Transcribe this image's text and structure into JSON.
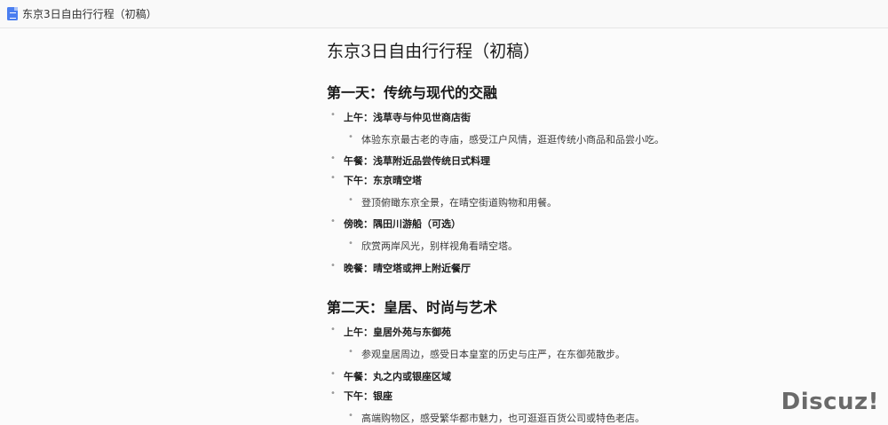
{
  "tab": {
    "title": "东京3日自由行行程（初稿）",
    "icon": "google-docs-icon"
  },
  "document": {
    "title": "东京3日自由行行程（初稿）",
    "sections": [
      {
        "heading": "第一天：传统与现代的交融",
        "items": [
          {
            "label": "上午：浅草寺与仲见世商店街",
            "sub": "体验东京最古老的寺庙，感受江户风情，逛逛传统小商品和品尝小吃。"
          },
          {
            "label": "午餐：浅草附近品尝传统日式料理"
          },
          {
            "label": "下午：东京晴空塔",
            "sub": "登顶俯瞰东京全景，在晴空街道购物和用餐。"
          },
          {
            "label": "傍晚：隅田川游船（可选）",
            "sub": "欣赏两岸风光，别样视角看晴空塔。"
          },
          {
            "label": "晚餐：晴空塔或押上附近餐厅"
          }
        ]
      },
      {
        "heading": "第二天：皇居、时尚与艺术",
        "items": [
          {
            "label": "上午：皇居外苑与东御苑",
            "sub": "参观皇居周边，感受日本皇室的历史与庄严，在东御苑散步。"
          },
          {
            "label": "午餐：丸之内或银座区域"
          },
          {
            "label": "下午：银座",
            "sub": "高端购物区，感受繁华都市魅力，也可逛逛百货公司或特色老店。"
          }
        ]
      }
    ]
  },
  "bullet_glyph": "•",
  "watermark": "Discuz!"
}
